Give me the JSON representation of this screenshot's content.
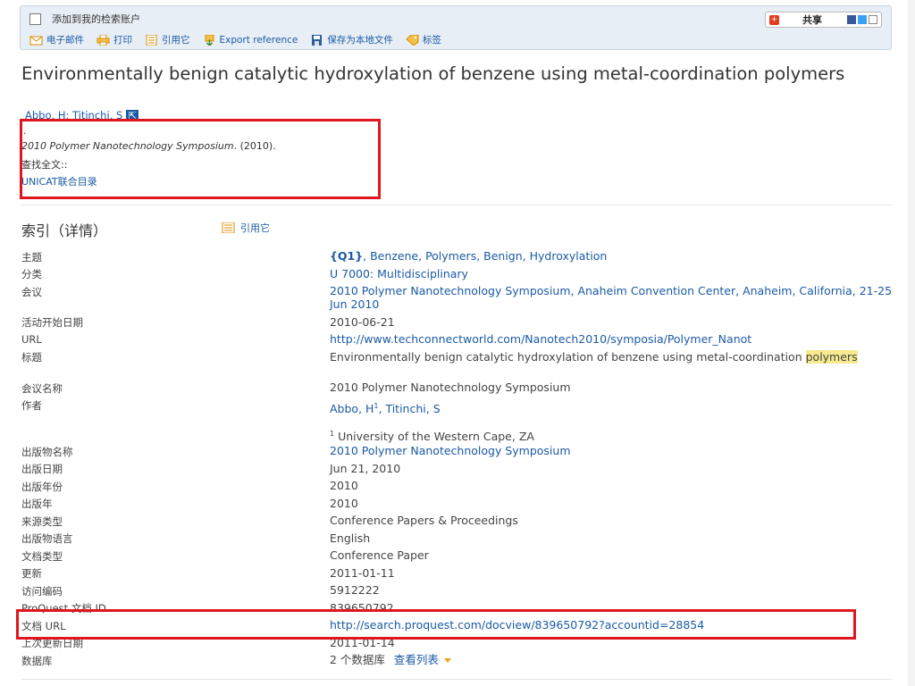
{
  "toolbar": {
    "add_to_account": "添加到我的检索账户",
    "email": "电子邮件",
    "print": "打印",
    "cite": "引用它",
    "export": "Export reference",
    "save_local": "保存为本地文件",
    "tags": "标签",
    "share": "共享"
  },
  "article": {
    "title": "Environmentally benign catalytic hydroxylation of benzene using metal-coordination polymers",
    "authors": "Abbo, H; Titinchi, S",
    "dot": ".",
    "source_italic": "2010 Polymer Nanotechnology Symposium",
    "source_rest": ". (2010).",
    "find_full_text": "查找全文::",
    "unicat": "UNICAT联合目录"
  },
  "index": {
    "heading": "索引（详情）",
    "cite": "引用它"
  },
  "fields": {
    "subject_label": "主题",
    "subject_q": "{Q1}",
    "subject_rest": ", Benzene, Polymers, Benign, Hydroxylation",
    "class_label": "分类",
    "class_value": "U 7000: Multidisciplinary",
    "conf_label": "会议",
    "conf_value": "2010 Polymer Nanotechnology Symposium, Anaheim Convention Center, Anaheim, California, 21-25 Jun 2010",
    "start_label": "活动开始日期",
    "start_value": "2010-06-21",
    "url_label": "URL",
    "url_value": "http://www.techconnectworld.com/Nanotech2010/symposia/Polymer_Nanot",
    "titlef_label": "标题",
    "titlef_value_a": "Environmentally benign catalytic hydroxylation of benzene using metal-coordination ",
    "titlef_value_hl": "polymers",
    "confname_label": "会议名称",
    "confname_value": "2010 Polymer Nanotechnology Symposium",
    "author_label": "作者",
    "author_a": "Abbo, H",
    "author_sup": "1",
    "author_b": ", Titinchi, S",
    "affil_sup": "1",
    "affil": "University of the Western Cape, ZA",
    "pubname_label": "出版物名称",
    "pubname_value": "2010 Polymer Nanotechnology Symposium",
    "pubdate_label": "出版日期",
    "pubdate_value": "Jun 21, 2010",
    "pubyear_label": "出版年份",
    "pubyear_value": "2010",
    "pubyr_label": "出版年",
    "pubyr_value": "2010",
    "srctype_label": "来源类型",
    "srctype_value": "Conference Papers & Proceedings",
    "lang_label": "出版物语言",
    "lang_value": "English",
    "doctype_label": "文档类型",
    "doctype_value": "Conference Paper",
    "updated_label": "更新",
    "updated_value": "2011-01-11",
    "access_label": "访问编码",
    "access_value": "5912222",
    "pqid_label": "ProQuest 文档 ID",
    "pqid_value": "839650792",
    "docurl_label": "文档 URL",
    "docurl_value": "http://search.proquest.com/docview/839650792?accountid=28854",
    "lastupd_label": "上次更新日期",
    "lastupd_value": "2011-01-14",
    "db_label": "数据库",
    "db_value": "2 个数据库",
    "db_link": "查看列表"
  },
  "colors": {
    "link": "#1a5aa6",
    "highlight_box": "#e0161f",
    "toolbar_bg": "#e8eef5"
  }
}
